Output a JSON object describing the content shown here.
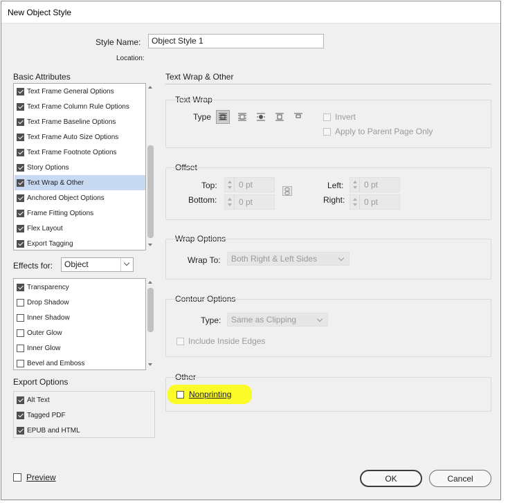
{
  "window": {
    "title": "New Object Style"
  },
  "header": {
    "style_name_label": "Style Name:",
    "style_name_value": "Object Style 1",
    "location_label": "Location:"
  },
  "basic_attributes": {
    "title": "Basic Attributes",
    "items": [
      {
        "label": "Text Frame General Options",
        "checked": true
      },
      {
        "label": "Text Frame Column Rule Options",
        "checked": true
      },
      {
        "label": "Text Frame Baseline Options",
        "checked": true
      },
      {
        "label": "Text Frame Auto Size Options",
        "checked": true
      },
      {
        "label": "Text Frame Footnote Options",
        "checked": true
      },
      {
        "label": "Story Options",
        "checked": true
      },
      {
        "label": "Text Wrap & Other",
        "checked": true,
        "selected": true
      },
      {
        "label": "Anchored Object Options",
        "checked": true
      },
      {
        "label": "Frame Fitting Options",
        "checked": true
      },
      {
        "label": "Flex Layout",
        "checked": true
      },
      {
        "label": "Export Tagging",
        "checked": true
      }
    ]
  },
  "effects": {
    "label": "Effects for:",
    "selected": "Object",
    "items": [
      {
        "label": "Transparency",
        "checked": true
      },
      {
        "label": "Drop Shadow",
        "checked": false
      },
      {
        "label": "Inner Shadow",
        "checked": false
      },
      {
        "label": "Outer Glow",
        "checked": false
      },
      {
        "label": "Inner Glow",
        "checked": false
      },
      {
        "label": "Bevel and Emboss",
        "checked": false
      }
    ]
  },
  "export_options": {
    "title": "Export Options",
    "items": [
      {
        "label": "Alt Text",
        "checked": true
      },
      {
        "label": "Tagged PDF",
        "checked": true
      },
      {
        "label": "EPUB and HTML",
        "checked": true
      }
    ]
  },
  "panel": {
    "title": "Text Wrap & Other",
    "text_wrap": {
      "title": "Text Wrap",
      "type_label": "Type",
      "wrap_types": [
        "no-text-wrap-icon",
        "wrap-bounding-box-icon",
        "wrap-object-shape-icon",
        "jump-object-icon",
        "jump-to-next-column-icon"
      ],
      "invert_label": "Invert",
      "apply_parent_label": "Apply to Parent Page Only"
    },
    "offset": {
      "title": "Offset",
      "top_label": "Top:",
      "bottom_label": "Bottom:",
      "left_label": "Left:",
      "right_label": "Right:",
      "top_value": "0 pt",
      "bottom_value": "0 pt",
      "left_value": "0 pt",
      "right_value": "0 pt"
    },
    "wrap_options": {
      "title": "Wrap Options",
      "wrap_to_label": "Wrap To:",
      "wrap_to_value": "Both Right & Left Sides"
    },
    "contour_options": {
      "title": "Contour Options",
      "type_label": "Type:",
      "type_value": "Same as Clipping",
      "include_inside_label": "Include Inside Edges"
    },
    "other": {
      "title": "Other",
      "nonprinting_label": "Nonprinting",
      "nonprinting_checked": false
    }
  },
  "footer": {
    "preview_label": "Preview",
    "preview_checked": false,
    "ok_label": "OK",
    "cancel_label": "Cancel"
  },
  "colors": {
    "selection": "#c7d9f3",
    "highlight": "#fbfb2a"
  }
}
